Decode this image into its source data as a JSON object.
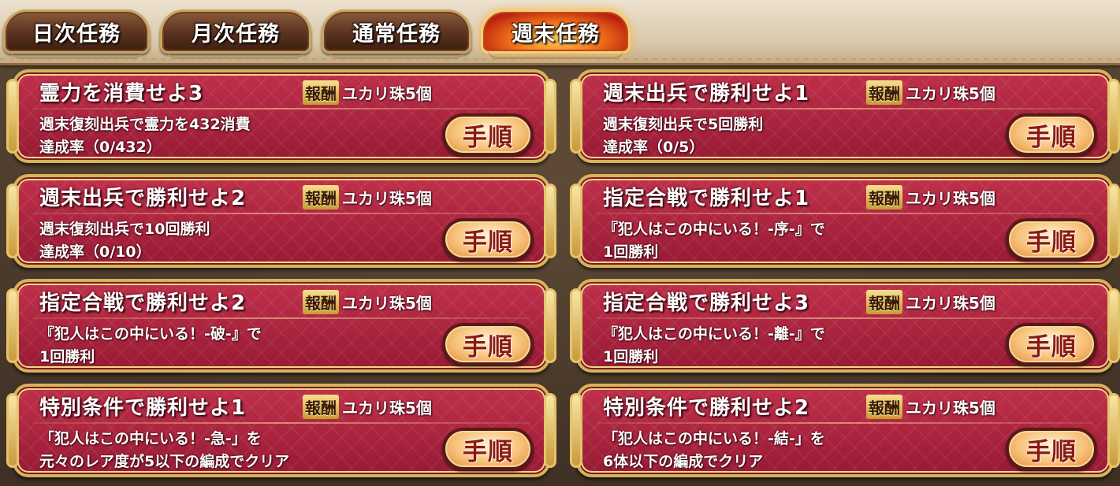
{
  "tabs": [
    {
      "label": "日次任務",
      "active": false
    },
    {
      "label": "月次任務",
      "active": false
    },
    {
      "label": "通常任務",
      "active": false
    },
    {
      "label": "週末任務",
      "active": true
    }
  ],
  "reward_badge_label": "報酬",
  "procedure_button_label": "手順",
  "missions": [
    {
      "title": "霊力を消費せよ3",
      "reward": "ユカリ珠5個",
      "line1": "週末復刻出兵で霊力を432消費",
      "line2": "達成率（0/432）"
    },
    {
      "title": "週末出兵で勝利せよ1",
      "reward": "ユカリ珠5個",
      "line1": "週末復刻出兵で5回勝利",
      "line2": "達成率（0/5）"
    },
    {
      "title": "週末出兵で勝利せよ2",
      "reward": "ユカリ珠5個",
      "line1": "週末復刻出兵で10回勝利",
      "line2": "達成率（0/10）"
    },
    {
      "title": "指定合戦で勝利せよ1",
      "reward": "ユカリ珠5個",
      "line1": "『犯人はこの中にいる！-序-』で",
      "line2": "1回勝利"
    },
    {
      "title": "指定合戦で勝利せよ2",
      "reward": "ユカリ珠5個",
      "line1": "『犯人はこの中にいる！-破-』で",
      "line2": "1回勝利"
    },
    {
      "title": "指定合戦で勝利せよ3",
      "reward": "ユカリ珠5個",
      "line1": "『犯人はこの中にいる！-離-』で",
      "line2": "1回勝利"
    },
    {
      "title": "特別条件で勝利せよ1",
      "reward": "ユカリ珠5個",
      "line1": "「犯人はこの中にいる！-急-」を",
      "line2": "元々のレア度が5以下の編成でクリア"
    },
    {
      "title": "特別条件で勝利せよ2",
      "reward": "ユカリ珠5個",
      "line1": "「犯人はこの中にいる！-結-」を",
      "line2": "6体以下の編成でクリア"
    }
  ]
}
